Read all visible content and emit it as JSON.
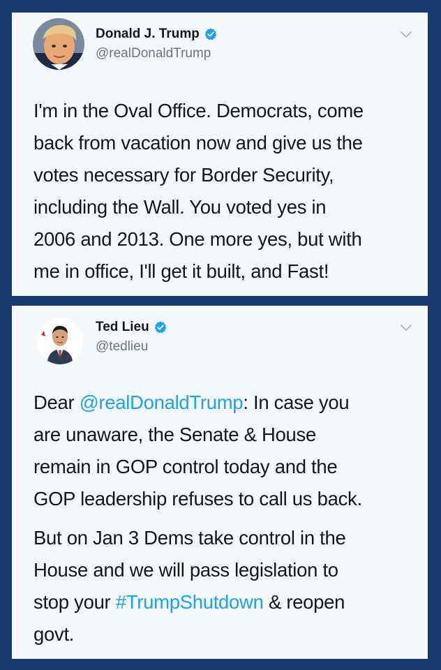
{
  "tweets": [
    {
      "name": "Donald J. Trump",
      "handle": "@realDonaldTrump",
      "verified": true,
      "text_lines": [
        "I'm in the Oval Office. Democrats, come",
        "back from vacation now and give us the",
        "votes necessary for Border Security,",
        "including the Wall. You voted yes in",
        "2006 and 2013. One more yes, but with",
        "me in office, I'll get it built, and Fast!"
      ]
    },
    {
      "name": "Ted Lieu",
      "handle": "@tedlieu",
      "verified": true,
      "para1": {
        "prefix": "Dear ",
        "mention": "@realDonaldTrump",
        "line1_suffix": ": In case you",
        "rest_lines": [
          "are unaware, the Senate & House",
          "remain in GOP control today and the",
          "GOP leadership refuses to call us back."
        ]
      },
      "para2": {
        "lines": [
          "But on Jan 3 Dems take control in the",
          "House and we will pass legislation to"
        ],
        "line3_prefix": "stop your ",
        "hashtag": "#TrumpShutdown",
        "line3_suffix": " & reopen",
        "line4": "govt."
      }
    }
  ],
  "colors": {
    "background": "#163a6e",
    "card": "#f5f8fb",
    "text": "#14171a",
    "muted": "#657786",
    "link": "#1da1f2",
    "verified": "#1da1f2"
  }
}
